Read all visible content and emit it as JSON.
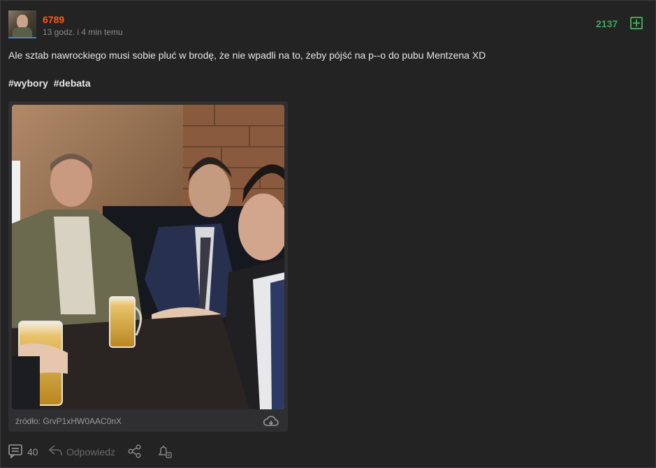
{
  "post": {
    "username": "6789",
    "time": "13 godz. i 4 min temu",
    "votes": "2137",
    "text": "Ale sztab nawrockiego musi sobie pluć w brodę, że nie wpadli na to, żeby pójść na p--o do pubu Mentzena XD",
    "tags": [
      "#wybory",
      "#debata"
    ]
  },
  "embed": {
    "source": "źródło: GrvP1xHW0AAC0nX"
  },
  "actions": {
    "comments_count": "40",
    "reply_label": "Odpowiedz"
  },
  "icons": {
    "vote": "plus-square-icon",
    "download": "cloud-download-icon",
    "comments": "comments-icon",
    "reply": "reply-icon",
    "share": "share-icon",
    "notify": "bell-icon"
  },
  "colors": {
    "background": "#232324",
    "username": "#ff5917",
    "votes": "#3fa858"
  }
}
